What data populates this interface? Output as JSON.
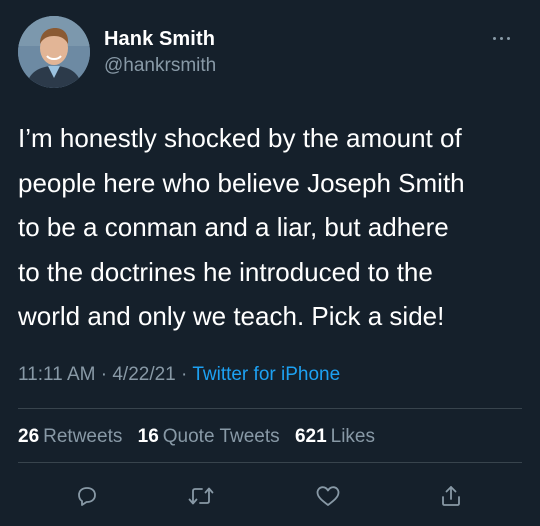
{
  "author": {
    "name": "Hank Smith",
    "handle": "@hankrsmith"
  },
  "tweet": {
    "text": "I’m honestly shocked by the amount of\npeople here who believe Joseph Smith\nto be a conman and a liar, but adhere\nto the doctrines he introduced to the\nworld and only we teach. Pick a side!",
    "time": "11:11 AM",
    "separator": "·",
    "date": "4/22/21",
    "source": "Twitter for iPhone"
  },
  "stats": {
    "retweets_count": "26",
    "retweets_label": "Retweets",
    "quotes_count": "16",
    "quotes_label": "Quote Tweets",
    "likes_count": "621",
    "likes_label": "Likes"
  },
  "actions": {
    "reply_icon": "reply-icon",
    "retweet_icon": "retweet-icon",
    "like_icon": "heart-icon",
    "share_icon": "share-icon"
  },
  "colors": {
    "background": "#15202b",
    "primary_text": "#ffffff",
    "secondary_text": "#8899a6",
    "accent": "#1da1f2",
    "divider": "#38444d"
  }
}
